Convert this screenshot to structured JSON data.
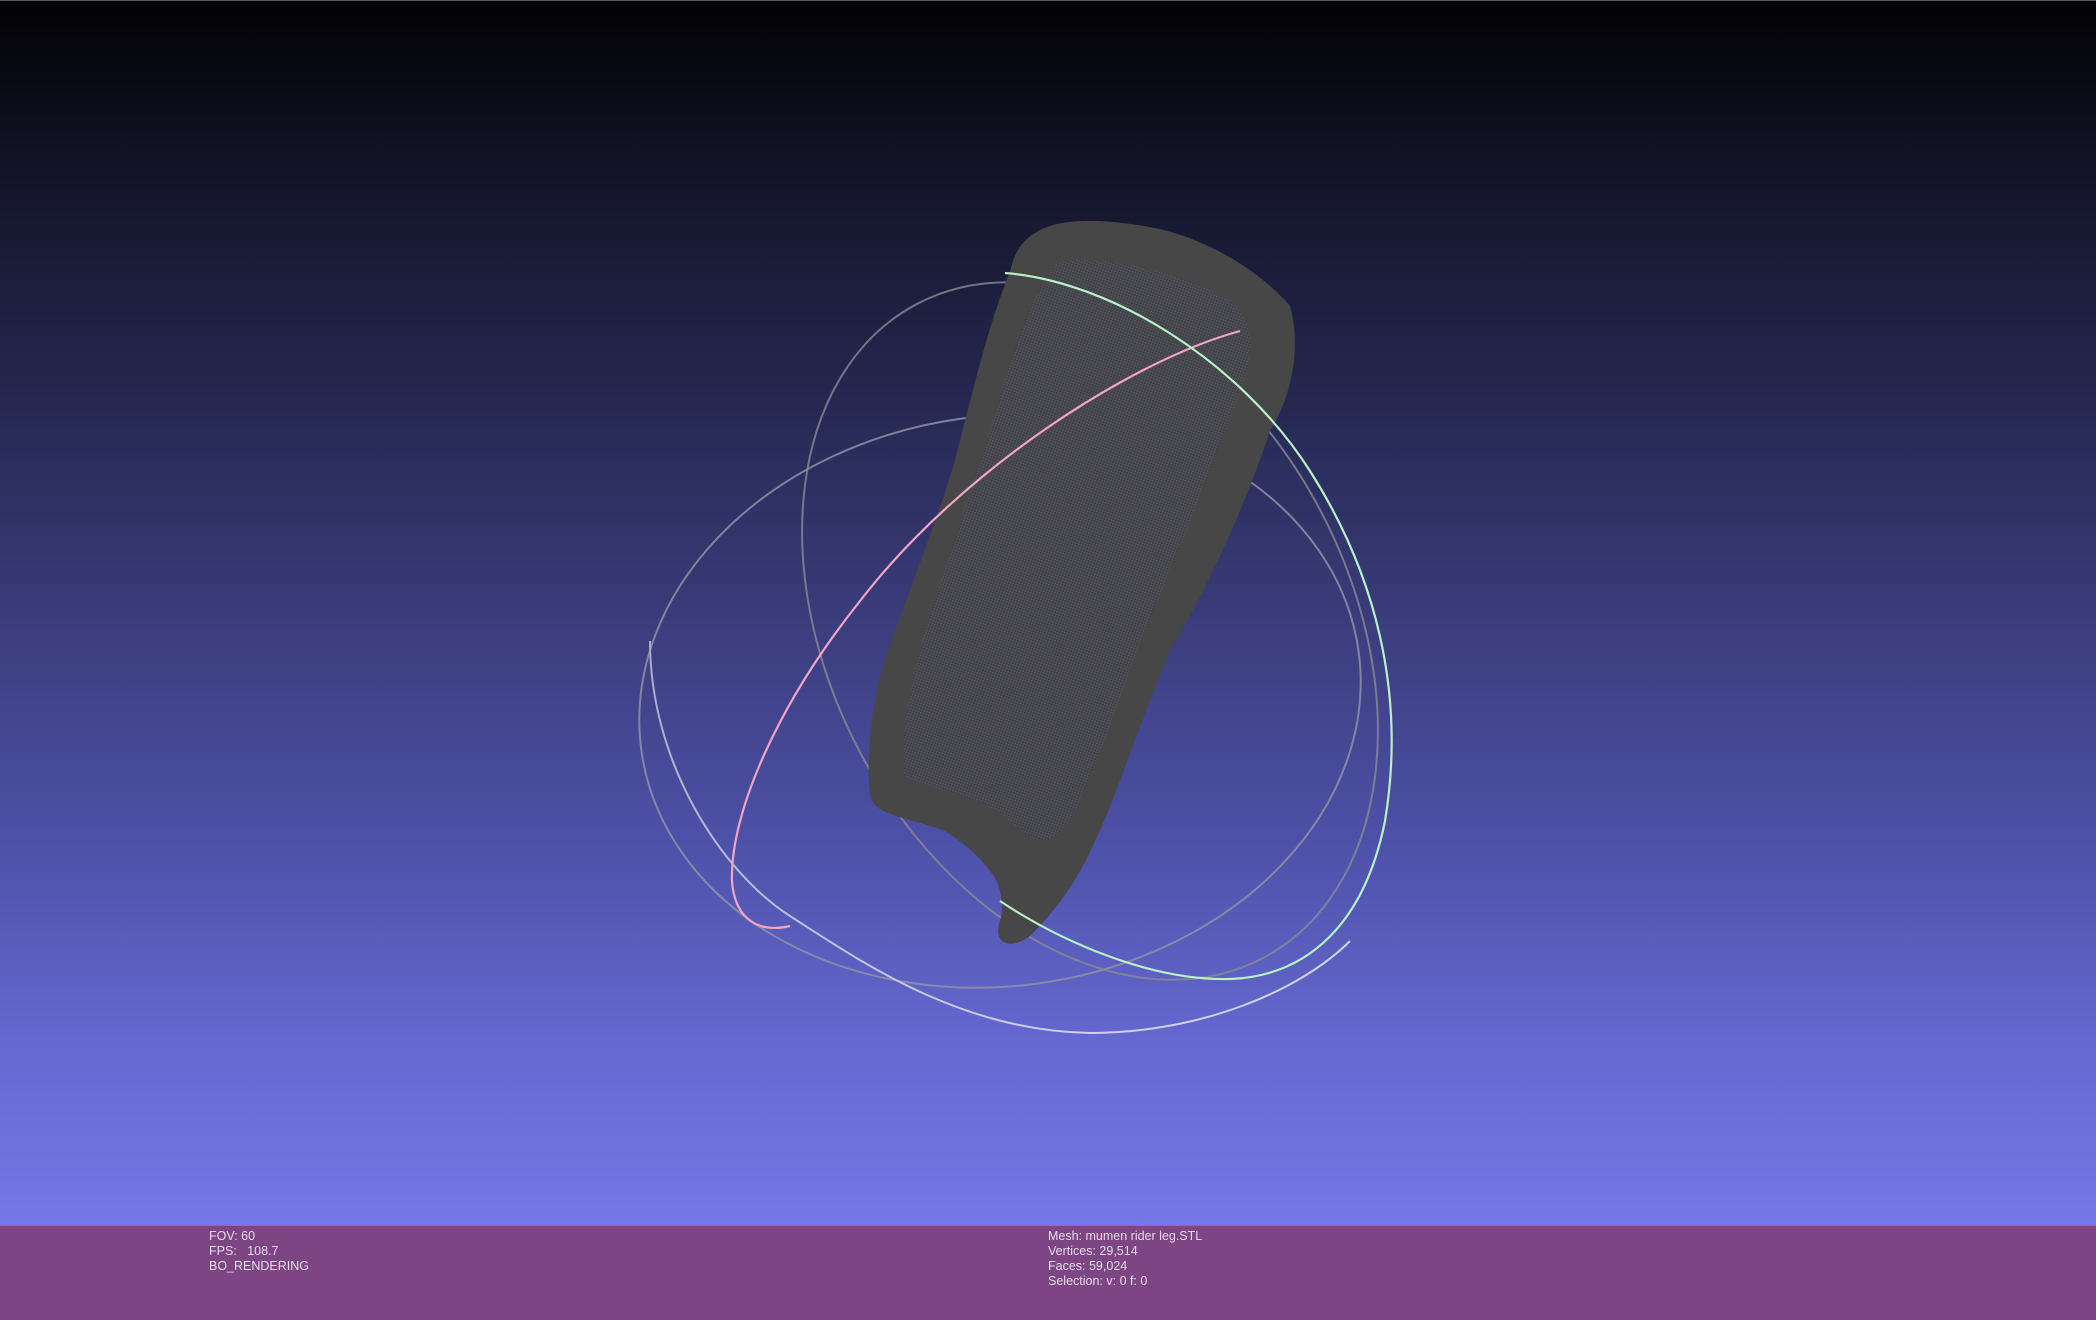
{
  "viewport": {
    "label": "3d-viewport",
    "background_top": "#020204",
    "background_bottom": "#7577e8",
    "mesh_color": "#4a4a4a",
    "trackball_colors": {
      "x_ring": "#f2a6c0",
      "y_ring": "#a6f2c0",
      "z_ring": "#c8c8f0"
    }
  },
  "info_bar": {
    "background": "#7d4584",
    "left": {
      "fov": "FOV: 60",
      "fps": "FPS:   108.7",
      "mode": "BO_RENDERING"
    },
    "right": {
      "mesh": "Mesh: mumen rider leg.STL",
      "vertices": "Vertices: 29,514",
      "faces": "Faces: 59,024",
      "selection": "Selection: v: 0 f: 0"
    }
  }
}
